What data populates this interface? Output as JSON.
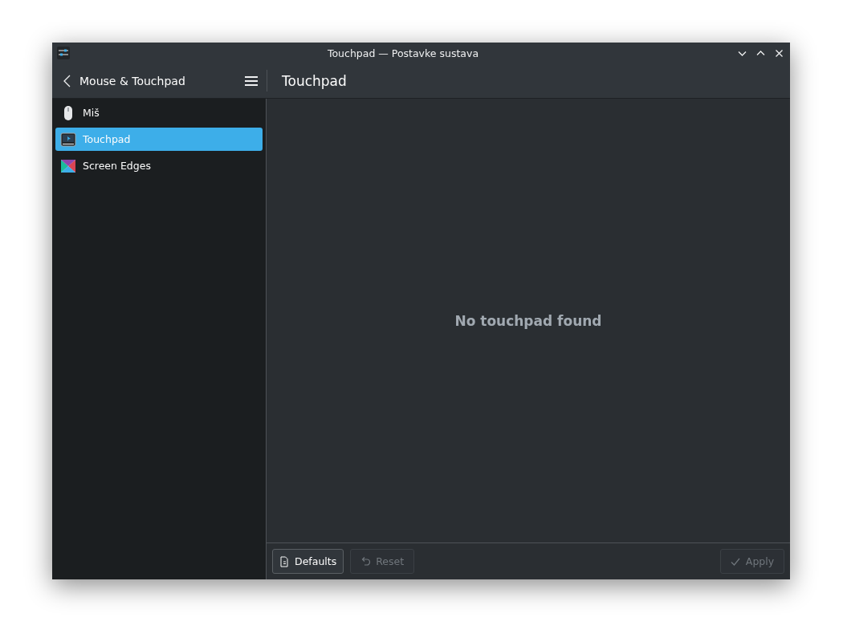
{
  "window": {
    "title": "Touchpad — Postavke sustava"
  },
  "sidebar": {
    "title": "Mouse & Touchpad",
    "items": [
      {
        "label": "Miš",
        "kind": "mouse",
        "selected": false
      },
      {
        "label": "Touchpad",
        "kind": "touchpad",
        "selected": true
      },
      {
        "label": "Screen Edges",
        "kind": "edges",
        "selected": false
      }
    ]
  },
  "page": {
    "title": "Touchpad",
    "message": "No touchpad found"
  },
  "buttons": [
    {
      "label": "Defaults",
      "kind": "defaults",
      "disabled": false
    },
    {
      "label": "Reset",
      "kind": "reset",
      "disabled": true
    },
    {
      "label": "Apply",
      "kind": "apply",
      "disabled": true
    }
  ]
}
